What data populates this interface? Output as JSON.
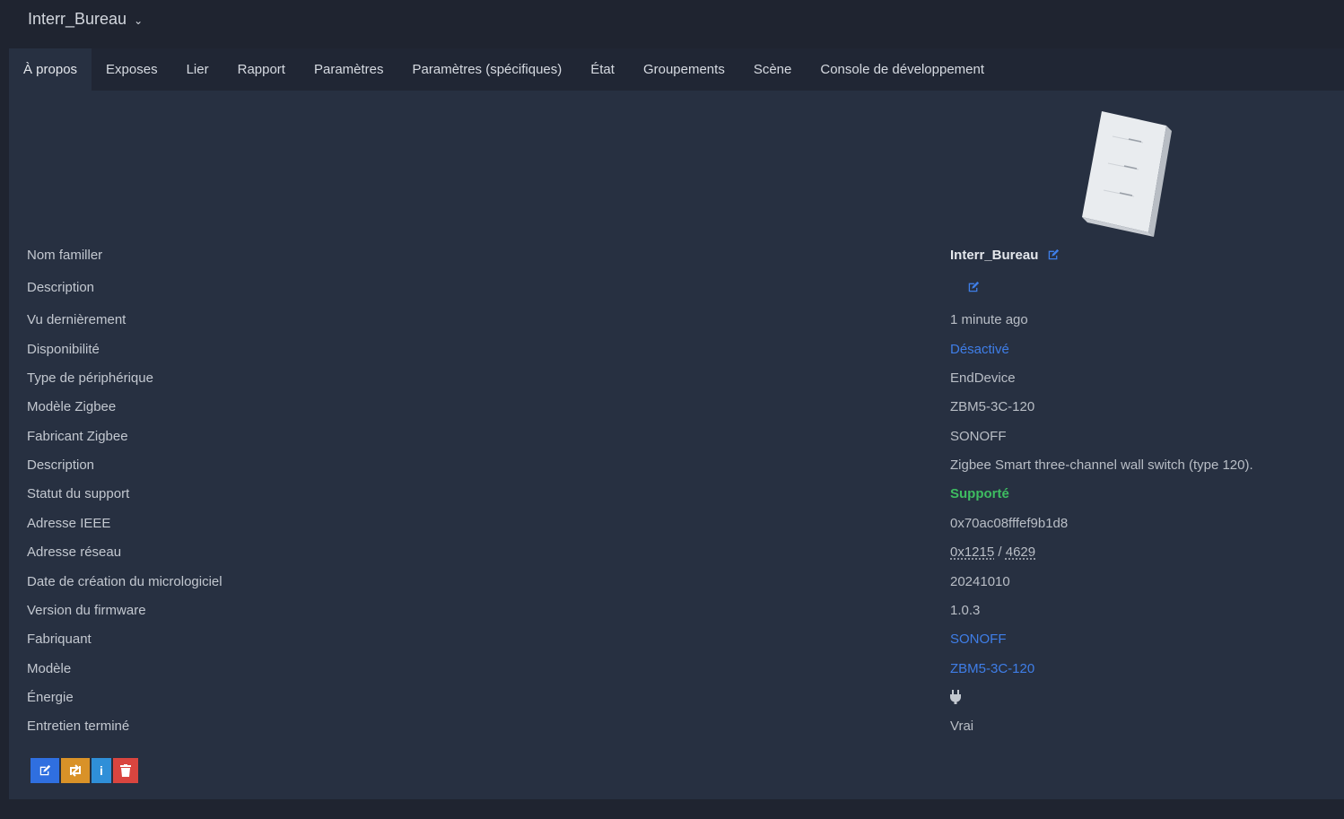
{
  "header": {
    "device_name": "Interr_Bureau"
  },
  "tabs": [
    {
      "label": "À propos",
      "active": true
    },
    {
      "label": "Exposes"
    },
    {
      "label": "Lier"
    },
    {
      "label": "Rapport"
    },
    {
      "label": "Paramètres"
    },
    {
      "label": "Paramètres (spécifiques)"
    },
    {
      "label": "État"
    },
    {
      "label": "Groupements"
    },
    {
      "label": "Scène"
    },
    {
      "label": "Console de développement"
    }
  ],
  "details": {
    "friendly_name": {
      "label": "Nom familler",
      "value": "Interr_Bureau"
    },
    "description1": {
      "label": "Description",
      "value": ""
    },
    "last_seen": {
      "label": "Vu dernièrement",
      "value": "1 minute ago"
    },
    "availability": {
      "label": "Disponibilité",
      "value": "Désactivé"
    },
    "device_type": {
      "label": "Type de périphérique",
      "value": "EndDevice"
    },
    "zigbee_model": {
      "label": "Modèle Zigbee",
      "value": "ZBM5-3C-120"
    },
    "zigbee_manufacturer": {
      "label": "Fabricant Zigbee",
      "value": "SONOFF"
    },
    "description2": {
      "label": "Description",
      "value": "Zigbee Smart three-channel wall switch (type 120)."
    },
    "support_status": {
      "label": "Statut du support",
      "value": "Supporté"
    },
    "ieee_address": {
      "label": "Adresse IEEE",
      "value": "0x70ac08fffef9b1d8"
    },
    "network_address": {
      "label": "Adresse réseau",
      "hex": "0x1215",
      "sep": " / ",
      "dec": "4629"
    },
    "firmware_date": {
      "label": "Date de création du micrologiciel",
      "value": "20241010"
    },
    "firmware_version": {
      "label": "Version du firmware",
      "value": "1.0.3"
    },
    "manufacturer": {
      "label": "Fabriquant",
      "value": "SONOFF"
    },
    "model": {
      "label": "Modèle",
      "value": "ZBM5-3C-120"
    },
    "power": {
      "label": "Énergie",
      "icon": "plug-icon"
    },
    "interview": {
      "label": "Entretien terminé",
      "value": "Vrai"
    }
  },
  "actions": [
    {
      "name": "edit-button",
      "icon": "edit-icon"
    },
    {
      "name": "reconfigure-button",
      "icon": "swap-icon"
    },
    {
      "name": "info-button",
      "icon": "info-icon",
      "text": "i"
    },
    {
      "name": "delete-button",
      "icon": "trash-icon"
    }
  ],
  "colors": {
    "link": "#3f7ee8",
    "supported": "#3ebd61",
    "edit_btn": "#2f6fe0",
    "swap_btn": "#d99228",
    "info_btn": "#2f8fd8",
    "delete_btn": "#d9453f"
  }
}
